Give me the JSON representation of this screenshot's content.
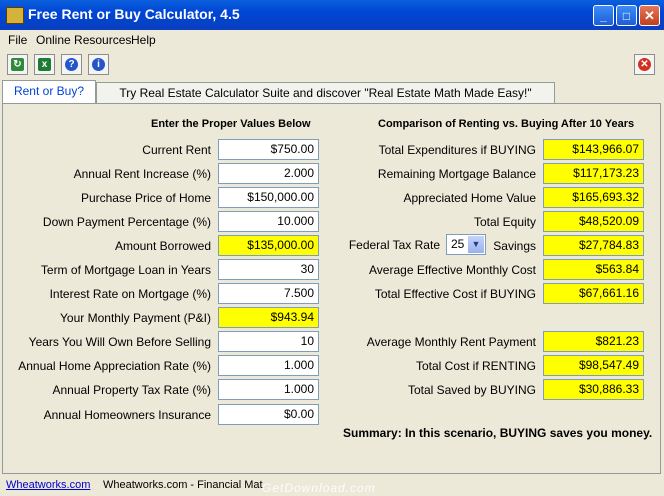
{
  "window": {
    "title": "Free Rent or Buy Calculator, 4.5"
  },
  "menu": [
    "File",
    "Online Resources",
    "Help"
  ],
  "tabs": {
    "active": "Rent or Buy?",
    "promo": "Try Real Estate Calculator Suite and discover \"Real Estate Math Made Easy!\""
  },
  "left": {
    "header": "Enter the Proper Values Below",
    "rows": [
      {
        "label": "Current Rent",
        "value": "$750.00",
        "highlight": false
      },
      {
        "label": "Annual Rent Increase (%)",
        "value": "2.000",
        "highlight": false
      },
      {
        "label": "Purchase Price of Home",
        "value": "$150,000.00",
        "highlight": false
      },
      {
        "label": "Down Payment Percentage (%)",
        "value": "10.000",
        "highlight": false
      },
      {
        "label": "Amount Borrowed",
        "value": "$135,000.00",
        "highlight": true
      },
      {
        "label": "Term of Mortgage Loan in Years",
        "value": "30",
        "highlight": false
      },
      {
        "label": "Interest Rate on Mortgage (%)",
        "value": "7.500",
        "highlight": false
      },
      {
        "label": "Your Monthly Payment (P&I)",
        "value": "$943.94",
        "highlight": true
      },
      {
        "label": "Years You Will Own Before Selling",
        "value": "10",
        "highlight": false
      },
      {
        "label": "Annual Home Appreciation Rate (%)",
        "value": "1.000",
        "highlight": false
      },
      {
        "label": "Annual Property Tax Rate (%)",
        "value": "1.000",
        "highlight": false
      },
      {
        "label": "Annual Homeowners Insurance",
        "value": "$0.00",
        "highlight": false
      }
    ]
  },
  "right": {
    "header": "Comparison of Renting vs. Buying After 10 Years",
    "rows": [
      {
        "label": "Total Expenditures if BUYING",
        "value": "$143,966.07"
      },
      {
        "label": "Remaining Mortgage Balance",
        "value": "$117,173.23"
      },
      {
        "label": "Appreciated Home Value",
        "value": "$165,693.32"
      },
      {
        "label": "Total Equity",
        "value": "$48,520.09"
      },
      {
        "label": "Savings",
        "value": "$27,784.83"
      },
      {
        "label": "Average Effective Monthly Cost",
        "value": "$563.84"
      },
      {
        "label": "Total Effective Cost if BUYING",
        "value": "$67,661.16"
      },
      {
        "label": "Average Monthly Rent Payment",
        "value": "$821.23"
      },
      {
        "label": "Total Cost if RENTING",
        "value": "$98,547.49"
      },
      {
        "label": "Total Saved by BUYING",
        "value": "$30,886.33"
      }
    ],
    "tax_label": "Federal Tax Rate",
    "tax_value": "25"
  },
  "summary": "Summary:  In this scenario, BUYING saves you money.",
  "status": {
    "link": "Wheatworks.com",
    "text": "Wheatworks.com - Financial Mat"
  },
  "watermark": "GetDownload.com",
  "colors": {
    "highlight": "#ffff00",
    "titlebar": "#0046d5"
  }
}
